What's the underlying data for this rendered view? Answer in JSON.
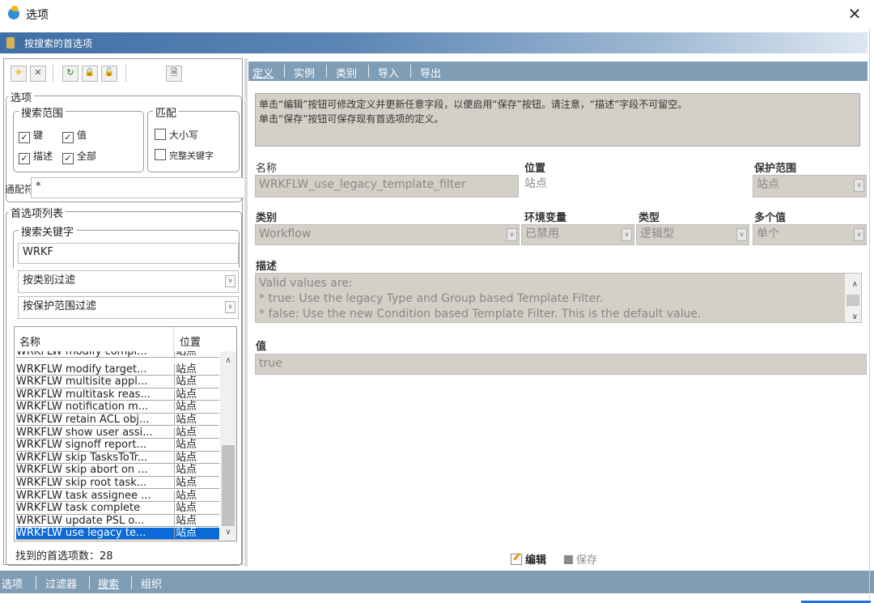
{
  "window": {
    "title": "选项",
    "close_glyph": "✕"
  },
  "header": {
    "title": "按搜索的首选项"
  },
  "toolbar": {
    "icons": [
      "add-icon",
      "delete-icon",
      "refresh-icon",
      "lock-icon",
      "unlock-icon",
      "document-icon"
    ],
    "glyphs": {
      "add": "✳",
      "delete": "✕",
      "refresh": "↻",
      "lock": "🔒",
      "unlock": "🔓",
      "doc": "🗎"
    }
  },
  "options": {
    "legend": "选项",
    "scope": {
      "legend": "搜索范围",
      "key": "键",
      "value": "值",
      "desc": "描述",
      "all": "全部"
    },
    "match": {
      "legend": "匹配",
      "case": "大小写",
      "whole": "完整关键字"
    },
    "wildcard_label": "通配符",
    "wildcard_value": "*"
  },
  "pref_list": {
    "legend": "首选项列表",
    "search_legend": "搜索关键字",
    "search_value": "WRKF",
    "filter_category": "按类别过滤",
    "filter_scope": "按保护范围过滤",
    "col_name": "名称",
    "col_location": "位置",
    "rows": [
      {
        "name": "WRKFLW modify compl...",
        "loc": "站点"
      },
      {
        "name": "WRKFLW modify target...",
        "loc": "站点"
      },
      {
        "name": "WRKFLW multisite appl...",
        "loc": "站点"
      },
      {
        "name": "WRKFLW multitask reas...",
        "loc": "站点"
      },
      {
        "name": "WRKFLW notification m...",
        "loc": "站点"
      },
      {
        "name": "WRKFLW retain ACL obj...",
        "loc": "站点"
      },
      {
        "name": "WRKFLW show user assi...",
        "loc": "站点"
      },
      {
        "name": "WRKFLW signoff report...",
        "loc": "站点"
      },
      {
        "name": "WRKFLW skip TasksToTr...",
        "loc": "站点"
      },
      {
        "name": "WRKFLW skip abort on ...",
        "loc": "站点"
      },
      {
        "name": "WRKFLW skip root task...",
        "loc": "站点"
      },
      {
        "name": "WRKFLW task assignee ...",
        "loc": "站点"
      },
      {
        "name": "WRKFLW task complete",
        "loc": "站点"
      },
      {
        "name": "WRKFLW update PSL o...",
        "loc": "站点"
      },
      {
        "name": "WRKFLW use legacy te...",
        "loc": "站点"
      }
    ],
    "found_text": "找到的首选项数：28"
  },
  "tabs": [
    "定义",
    "实例",
    "类别",
    "导入",
    "导出"
  ],
  "detail": {
    "info_line1": "单击“编辑”按钮可修改定义并更新任意字段，以便启用“保存”按钮。请注意，“描述”字段不可留空。",
    "info_line2": "单击“保存”按钮可保存现有首选项的定义。",
    "name_label": "名称",
    "name_value": "WRKFLW_use_legacy_template_filter",
    "location_label": "位置",
    "location_value": "站点",
    "protection_label": "保护范围",
    "protection_value": "站点",
    "category_label": "类别",
    "category_value": "Workflow",
    "env_label": "环境变量",
    "env_value": "已禁用",
    "type_label": "类型",
    "type_value": "逻辑型",
    "multi_label": "多个值",
    "multi_value": "单个",
    "desc_label": "描述",
    "desc_lines": [
      "Valid values are:",
      "* true: Use the legacy Type and Group based Template Filter.",
      "* false: Use the new Condition based Template Filter. This is the default value."
    ],
    "value_label": "值",
    "value_value": "true",
    "edit_label": "编辑",
    "save_label": "保存"
  },
  "bottom_tabs": [
    "选项",
    "过滤器",
    "搜索",
    "组织"
  ],
  "colors": {
    "accent": "#7f9db5",
    "selection": "#0a6ad7",
    "readonly_bg": "#d4d0c8"
  }
}
